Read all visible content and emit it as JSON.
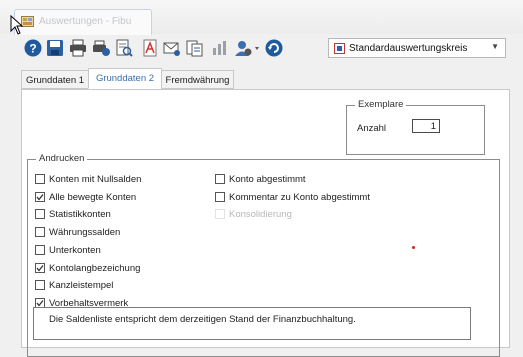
{
  "window": {
    "title": "Auswertungen - Fibu"
  },
  "toolbar": {
    "buttons": [
      {
        "icon": "help-icon"
      },
      {
        "icon": "save-icon"
      },
      {
        "icon": "print-icon"
      },
      {
        "icon": "print-setup-icon"
      },
      {
        "icon": "preview-icon"
      },
      {
        "icon": "pdf-icon"
      },
      {
        "icon": "email-icon"
      },
      {
        "icon": "export-icon"
      },
      {
        "icon": "chart-icon"
      },
      {
        "icon": "user-settings-icon"
      },
      {
        "icon": "refresh-icon"
      }
    ],
    "combo": {
      "value": "Standardauswertungskreis"
    }
  },
  "tabs": [
    "Grunddaten 1",
    "Grunddaten 2",
    "Fremdwährung"
  ],
  "active_tab": "Grunddaten 2",
  "exemplare": {
    "legend": "Exemplare",
    "anzahl_label": "Anzahl",
    "anzahl_value": "1"
  },
  "andrucken": {
    "legend": "Andrucken",
    "left": [
      {
        "label": "Konten mit Nullsalden",
        "checked": false
      },
      {
        "label": "Alle bewegte Konten",
        "checked": true
      },
      {
        "label": "Statistikkonten",
        "checked": false
      },
      {
        "label": "Währungssalden",
        "checked": false
      },
      {
        "label": "Unterkonten",
        "checked": false
      },
      {
        "label": "Kontolangbezeichung",
        "checked": true
      },
      {
        "label": "Kanzleistempel",
        "checked": false
      },
      {
        "label": "Vorbehaltsvermerk",
        "checked": true
      }
    ],
    "right": [
      {
        "label": "Konto abgestimmt",
        "checked": false,
        "disabled": false
      },
      {
        "label": "Kommentar zu Konto abgestimmt",
        "checked": false,
        "disabled": false
      },
      {
        "label": "Konsolidierung",
        "checked": false,
        "disabled": true
      }
    ],
    "note": "Die Saldenliste entspricht dem derzeitigen Stand der Finanzbuchhaltung."
  }
}
